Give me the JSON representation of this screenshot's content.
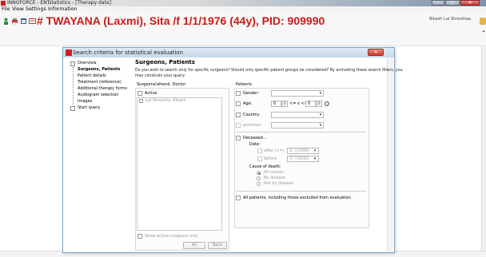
{
  "window": {
    "title": "INNOFORCE - ENTstatistics - [Therapy data]"
  },
  "menu": {
    "items": [
      "File",
      "View",
      "Settings",
      "Information"
    ]
  },
  "patient": {
    "header": "# TWAYANA (Laxmi), Sita /f 1/1/1976 (44y), PID: 909990",
    "user": "Bikash Lal Shresthaa"
  },
  "toolbar": {
    "icons": [
      "person-icon",
      "printer-icon",
      "calendar-icon",
      "card-icon"
    ]
  },
  "dialog": {
    "title": "Search criteria for statistical evaluation",
    "close_label": "✕",
    "tree": [
      "Overview",
      "Surgeons, Patients",
      "Patient details",
      "Treatment (reference)",
      "Additional therapy forms",
      "Audiogram selection",
      "Images",
      "Start query"
    ],
    "heading": "Surgeons, Patients",
    "description_line1": "Do you wish to search only for specific surgeons? Should only specific patient groups be considered? By activating these search filters, you",
    "description_line2": "may constrain your query.",
    "surgeons": {
      "header": "Surgeons/attend. Doctor",
      "active_label": "Active",
      "list": [
        "Lal Shrestha, Bikash"
      ],
      "show_active_label": "Show active surgeons only",
      "all_button": "All",
      "none_button": "None"
    },
    "patients": {
      "header": "Patients",
      "gender_label": "Gender:",
      "age_label": "Age:",
      "age_from": "0",
      "age_op": "<= x <=",
      "age_to": "0",
      "country_label": "Country:",
      "province_label": "province:",
      "deceased_label": "Deceased...",
      "date_label": "Date:",
      "after_label": "after (>=)",
      "after_value": "1/ 1/1900",
      "before_label": "before",
      "before_value": "7/ 7/2020",
      "cause_label": "Cause of death:",
      "causes": [
        "All causes",
        "By disease",
        "Not by disease"
      ],
      "all_patients_label": "All patients, including those excluded from evaluation"
    }
  },
  "colors": {
    "accent_red": "#cc1a1a",
    "dialog_border": "#7fa5c9"
  }
}
